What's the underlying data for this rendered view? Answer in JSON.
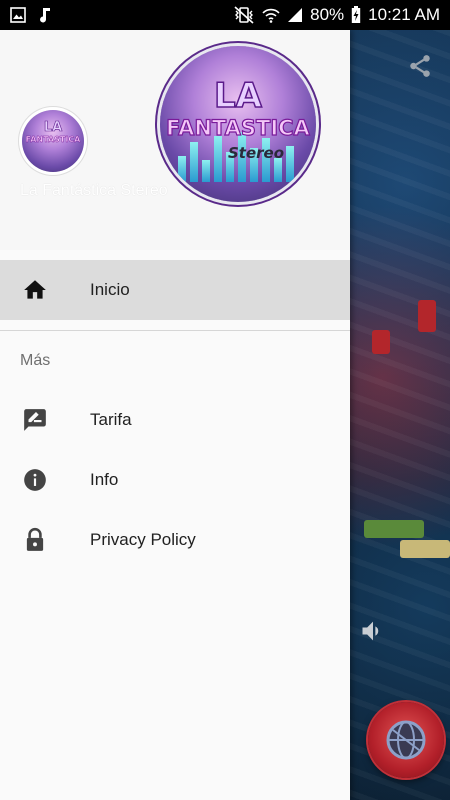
{
  "status_bar": {
    "battery": "80%",
    "time": "10:21 AM",
    "icons": [
      "gallery-icon",
      "music-note-icon",
      "vibrate-mute-icon",
      "wifi-icon",
      "signal-icon",
      "battery-charging-icon"
    ]
  },
  "drawer": {
    "logo": {
      "line1": "LA",
      "line2": "FANTASTICA",
      "line3": "Stereo"
    },
    "station_name": "La Fantástica Stereo",
    "primary_items": [
      {
        "label": "Inicio",
        "icon": "home-icon",
        "active": true
      }
    ],
    "section_title": "Más",
    "secondary_items": [
      {
        "label": "Tarifa",
        "icon": "rate-review-icon"
      },
      {
        "label": "Info",
        "icon": "info-icon"
      },
      {
        "label": "Privacy Policy",
        "icon": "lock-icon"
      }
    ]
  },
  "background_app": {
    "actions": [
      "share-icon",
      "volume-icon",
      "play-globe-icon"
    ]
  },
  "colors": {
    "accent_red": "#b3202a",
    "drawer_bg": "#fafafa",
    "active_item_bg": "#dcdcdc"
  }
}
